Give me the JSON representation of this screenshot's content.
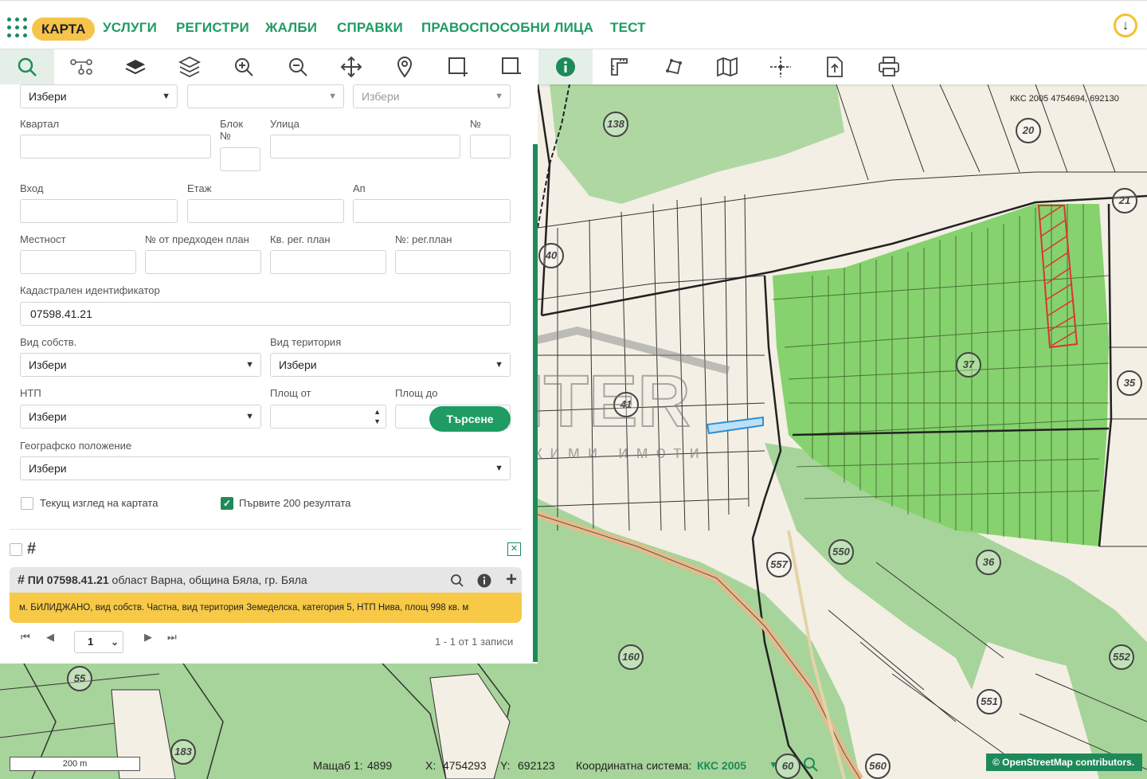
{
  "nav": {
    "active": "КАРТА",
    "items": [
      "УСЛУГИ",
      "РЕГИСТРИ",
      "ЖАЛБИ",
      "СПРАВКИ",
      "ПРАВОСПОСОБНИ ЛИЦА",
      "ТЕСТ"
    ]
  },
  "toolbar": {
    "icons": [
      "search-icon",
      "route-icon",
      "layer-icon",
      "layers-icon",
      "zoom-in-icon",
      "zoom-out-icon",
      "pan-icon",
      "location-pin-icon",
      "select-rectangle-icon",
      "deselect-rectangle-icon",
      "info-icon",
      "measure-icon",
      "polygon-icon",
      "map-icon",
      "crosshair-icon",
      "export-icon",
      "print-icon"
    ]
  },
  "form": {
    "top_select_1": "Избери",
    "top_select_2": "",
    "top_select_3": "Избери",
    "kvartal_label": "Квартал",
    "blok_label": "Блок №",
    "ulica_label": "Улица",
    "no_label": "№",
    "vhod_label": "Вход",
    "etaj_label": "Етаж",
    "ap_label": "Ап",
    "mestnost_label": "Местност",
    "prev_plan_label": "№ от предходен план",
    "kv_reg_plan_label": "Кв. рег. план",
    "no_reg_plan_label": "№: рег.план",
    "cadastral_label": "Кадастрален идентификатор",
    "cadastral_value": "07598.41.21",
    "ownership_label": "Вид собств.",
    "ownership_value": "Избери",
    "territory_label": "Вид територия",
    "territory_value": "Избери",
    "ntp_label": "НТП",
    "ntp_value": "Избери",
    "area_from_label": "Площ от",
    "area_to_label": "Площ до",
    "geo_label": "Географско положение",
    "geo_value": "Избери",
    "current_view_label": "Текущ изглед на картата",
    "first200_label": "Първите 200 резултата",
    "search_button": "Търсене"
  },
  "result": {
    "title_bold": "ПИ 07598.41.21",
    "title_rest": " област Варна, община Бяла, гр. Бяла",
    "details": "м. БИЛИДЖАНО, вид собств. Частна, вид територия Земеделска, категория 5, НТП Нива, площ 998 кв. м"
  },
  "pager": {
    "page": "1",
    "summary": "1 - 1 от 1 записи"
  },
  "map": {
    "coords_top": "ККС 2005 4754694, 692130",
    "parcel_labels": [
      "138",
      "20",
      "21",
      "40",
      "37",
      "35",
      "41",
      "550",
      "557",
      "36",
      "160",
      "552",
      "551",
      "55",
      "183",
      "60",
      "560"
    ]
  },
  "status": {
    "scale_bar": "200 m",
    "scale_label": "Мащаб 1:",
    "scale_value": "4899",
    "x_label": "X:",
    "x_value": "4754293",
    "y_label": "Y:",
    "y_value": "692123",
    "crs_label": "Координатна система:",
    "crs_value": "ККС 2005",
    "osm": "© OpenStreetMap contributors."
  },
  "watermark": {
    "brand": "ENTER",
    "sub": "недвижими имоти"
  }
}
